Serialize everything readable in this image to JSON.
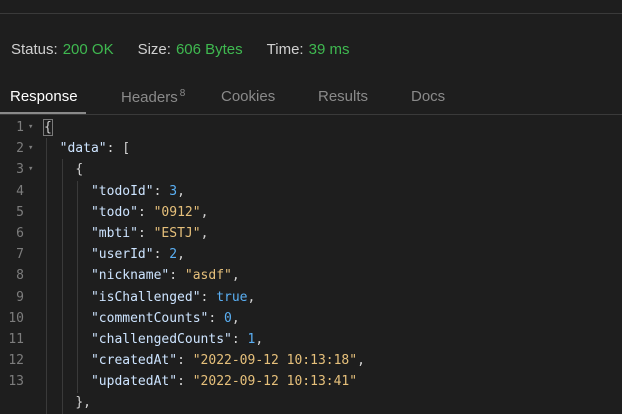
{
  "status": {
    "status_label": "Status:",
    "status_value": "200 OK",
    "size_label": "Size:",
    "size_value": "606 Bytes",
    "time_label": "Time:",
    "time_value": "39 ms",
    "value_color": "#3fb950"
  },
  "tabs": {
    "response": "Response",
    "headers": "Headers",
    "headers_count": "8",
    "cookies": "Cookies",
    "results": "Results",
    "docs": "Docs",
    "active": "Response"
  },
  "code": {
    "lines": [
      {
        "n": "1",
        "fold": true,
        "text": "{"
      },
      {
        "n": "2",
        "fold": true,
        "text": "  \"data\": ["
      },
      {
        "n": "3",
        "fold": true,
        "text": "    {"
      },
      {
        "n": "4",
        "fold": false,
        "text": "      \"todoId\": 3,"
      },
      {
        "n": "5",
        "fold": false,
        "text": "      \"todo\": \"0912\","
      },
      {
        "n": "6",
        "fold": false,
        "text": "      \"mbti\": \"ESTJ\","
      },
      {
        "n": "7",
        "fold": false,
        "text": "      \"userId\": 2,"
      },
      {
        "n": "8",
        "fold": false,
        "text": "      \"nickname\": \"asdf\","
      },
      {
        "n": "9",
        "fold": false,
        "text": "      \"isChallenged\": true,"
      },
      {
        "n": "10",
        "fold": false,
        "text": "      \"commentCounts\": 0,"
      },
      {
        "n": "11",
        "fold": false,
        "text": "      \"challengedCounts\": 1,"
      },
      {
        "n": "12",
        "fold": false,
        "text": "      \"createdAt\": \"2022-09-12 10:13:18\","
      },
      {
        "n": "13",
        "fold": false,
        "text": "      \"updatedAt\": \"2022-09-12 10:13:41\""
      },
      {
        "n": "",
        "fold": false,
        "text": "    },"
      }
    ]
  }
}
